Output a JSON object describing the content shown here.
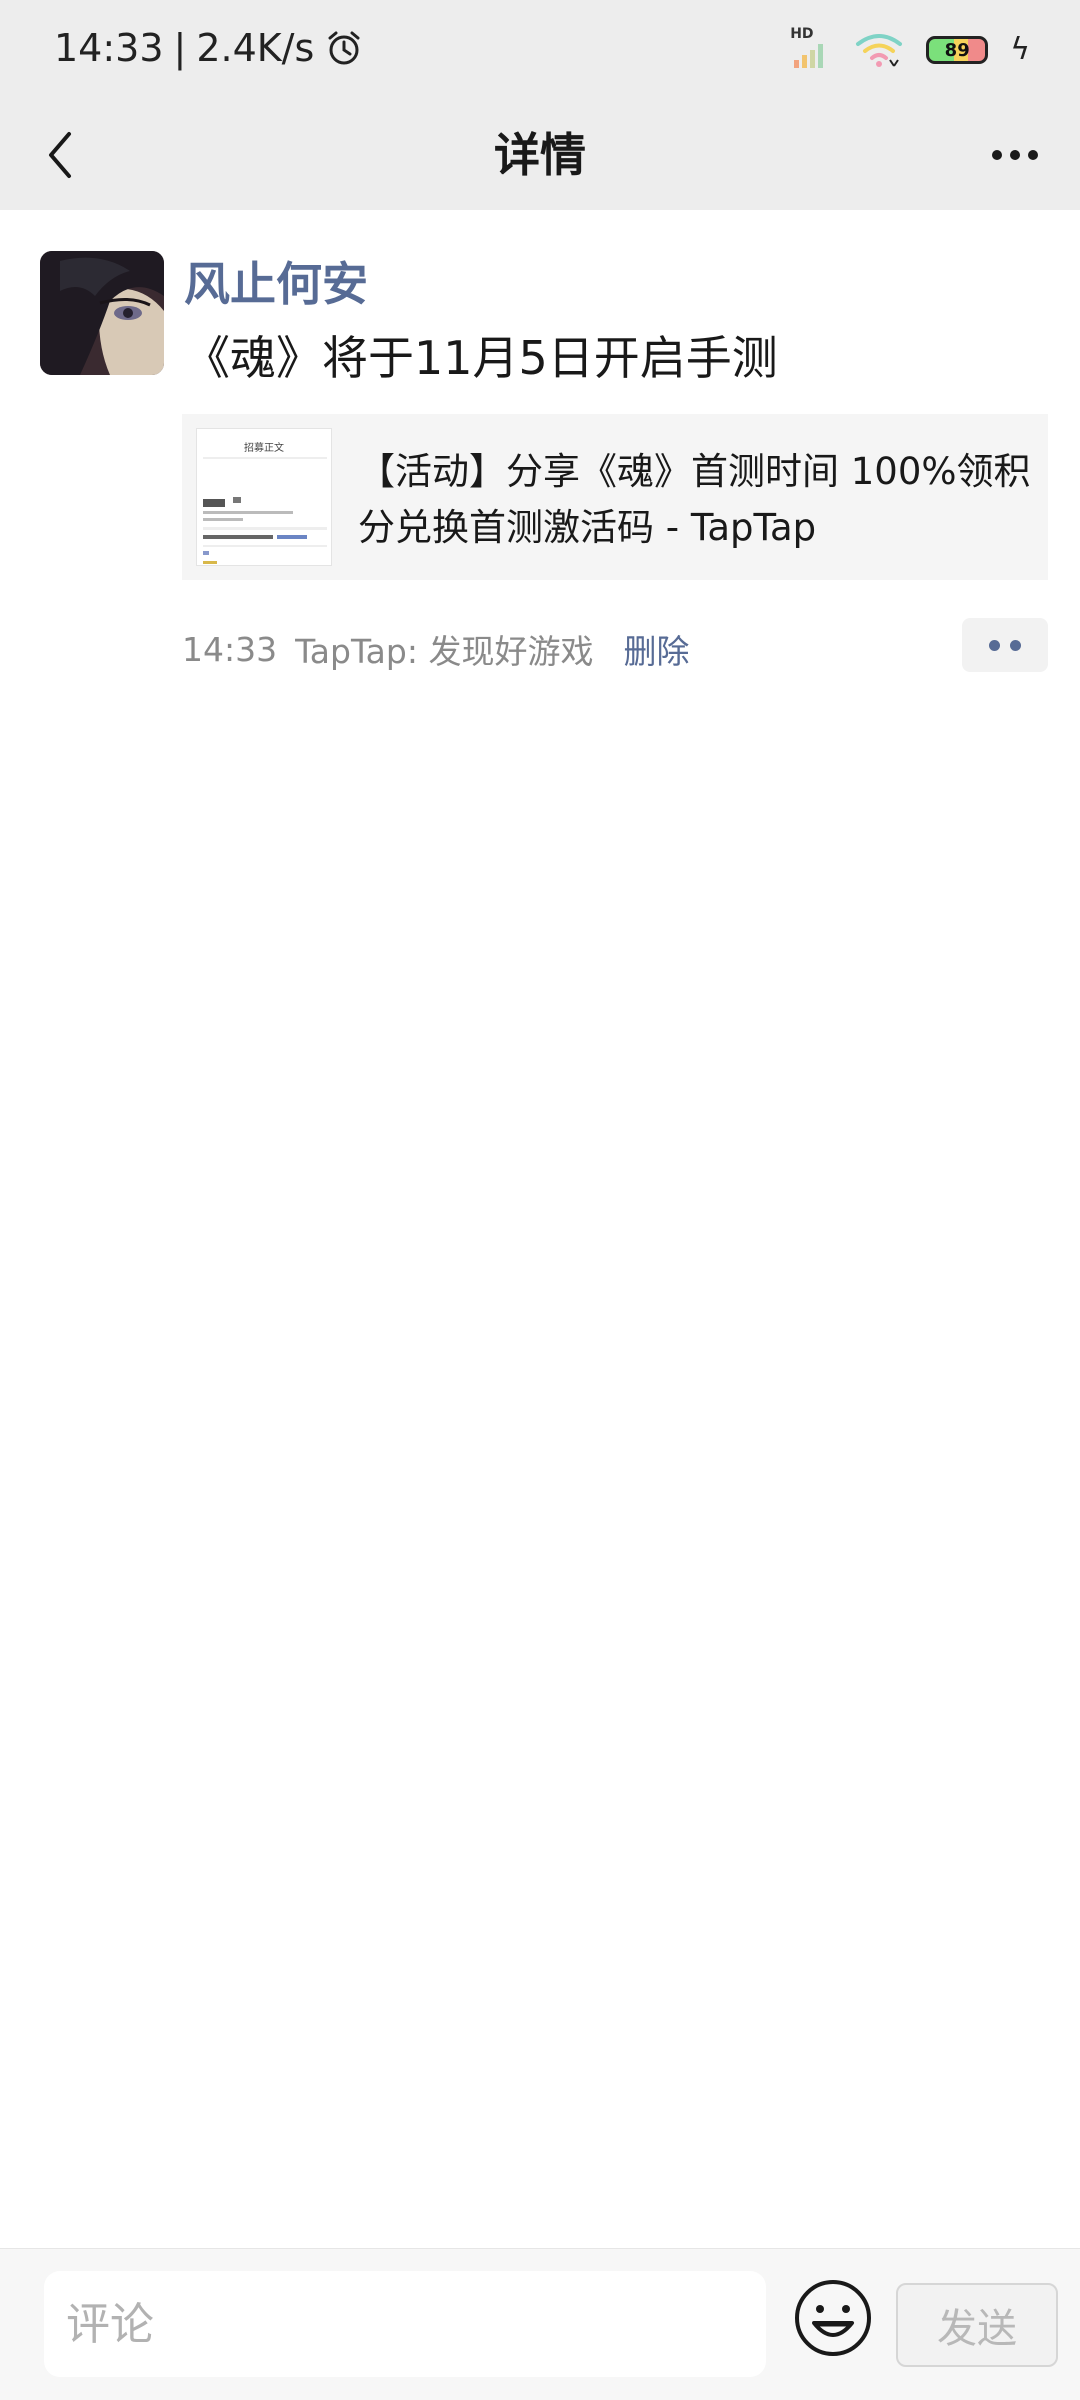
{
  "status_bar": {
    "time": "14:33",
    "separator": "|",
    "speed": "2.4K/s",
    "signal_label": "HD",
    "battery": "89"
  },
  "nav": {
    "title": "详情"
  },
  "post": {
    "author": "风止何安",
    "text": "《魂》将于11月5日开启手测",
    "link": {
      "title": "【活动】分享《魂》首测时间 100%领积分兑换首测激活码 - TapTap",
      "thumb_title": "招募正文"
    },
    "time": "14:33",
    "source": "TapTap: 发现好游戏",
    "delete_label": "删除"
  },
  "comment_bar": {
    "placeholder": "评论",
    "send_label": "发送"
  }
}
